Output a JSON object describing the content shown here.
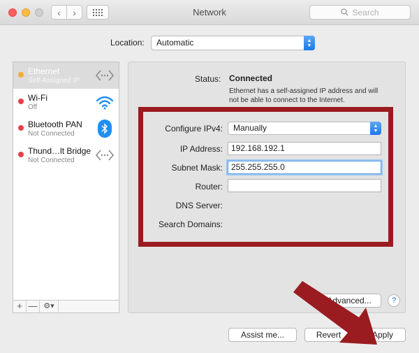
{
  "window": {
    "title": "Network",
    "search_placeholder": "Search"
  },
  "location": {
    "label": "Location:",
    "value": "Automatic"
  },
  "services": [
    {
      "name": "Ethernet",
      "status": "Self-Assigned IP",
      "dot": "yellow",
      "icon": "ethernet-icon",
      "selected": true
    },
    {
      "name": "Wi-Fi",
      "status": "Off",
      "dot": "red",
      "icon": "wifi-icon"
    },
    {
      "name": "Bluetooth PAN",
      "status": "Not Connected",
      "dot": "red",
      "icon": "bluetooth-icon"
    },
    {
      "name": "Thund…lt Bridge",
      "status": "Not Connected",
      "dot": "red",
      "icon": "thunderbolt-bridge-icon"
    }
  ],
  "sidebar_toolbar": {
    "add": "+",
    "remove": "—"
  },
  "status": {
    "label": "Status:",
    "value": "Connected",
    "description": "Ethernet has a self-assigned IP address and will not be able to connect to the Internet."
  },
  "config": {
    "configure_ipv4_label": "Configure IPv4:",
    "configure_ipv4_value": "Manually",
    "ip_address_label": "IP Address:",
    "ip_address_value": "192.168.192.1",
    "subnet_mask_label": "Subnet Mask:",
    "subnet_mask_value": "255.255.255.0",
    "router_label": "Router:",
    "router_value": "",
    "dns_server_label": "DNS Server:",
    "search_domains_label": "Search Domains:"
  },
  "buttons": {
    "advanced": "Advanced...",
    "help": "?",
    "assist": "Assist me...",
    "revert": "Revert",
    "apply": "Apply"
  },
  "colors": {
    "highlight_border": "#9a1b20",
    "accent_blue": "#1a79e8",
    "status_yellow": "#f2ad34",
    "status_red": "#e6414a"
  }
}
